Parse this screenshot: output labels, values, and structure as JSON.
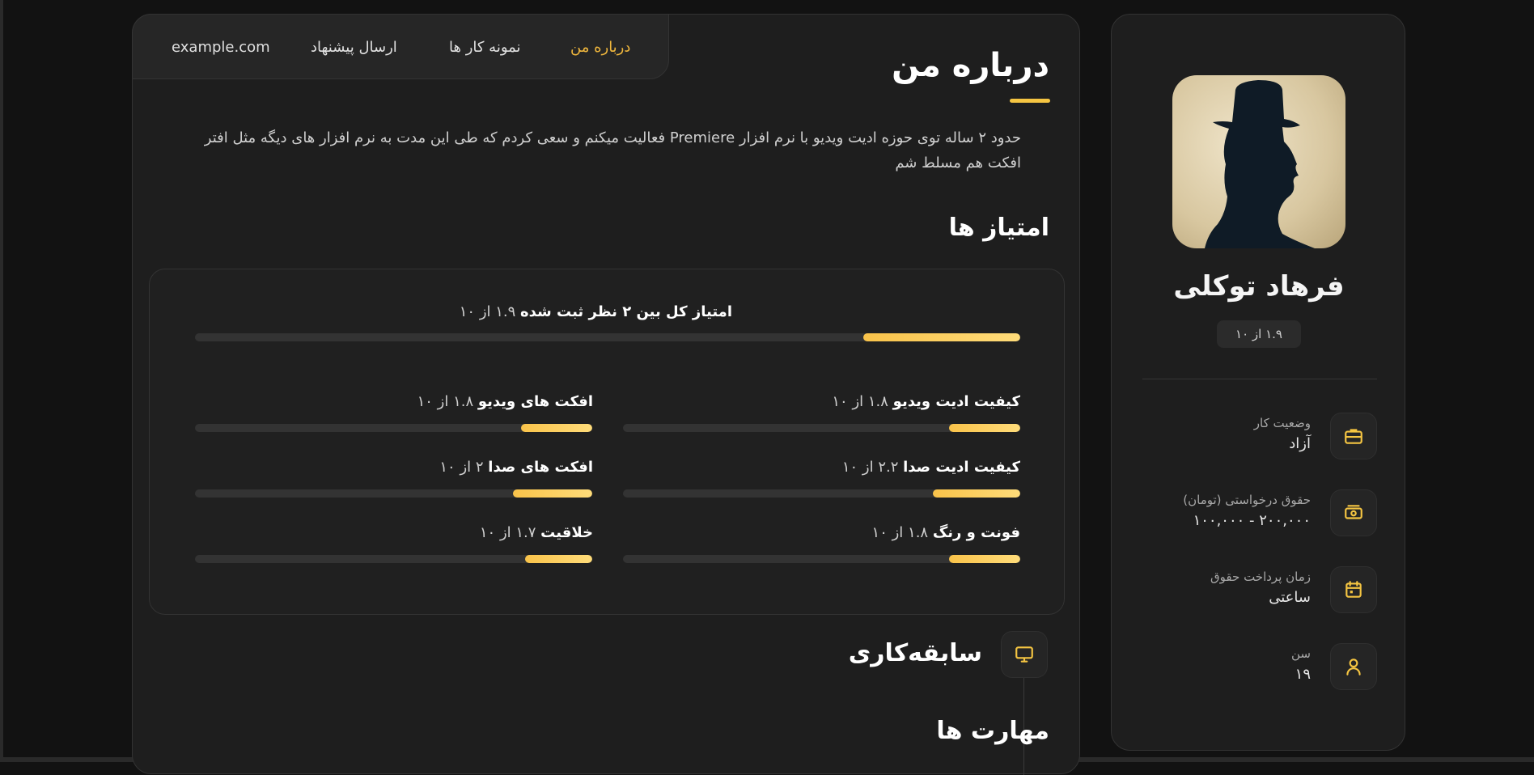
{
  "nav": {
    "items": [
      {
        "label": "درباره من",
        "active": true
      },
      {
        "label": "نمونه کار ها",
        "active": false
      },
      {
        "label": "ارسال پیشنهاد",
        "active": false
      },
      {
        "label": "example.com",
        "active": false
      }
    ]
  },
  "about": {
    "title": "درباره من",
    "text": "حدود ۲ ساله توی حوزه ادیت ویدیو با نرم افزار Premiere فعالیت میکنم و سعی کردم که طی این مدت به نرم افزار های دیگه مثل افتر افکت هم مسلط شم"
  },
  "scores": {
    "title": "امتیاز ها",
    "overall": {
      "label": "امتیاز کل بین ۲ نظر ثبت شده",
      "value_text": "۱.۹ از ۱۰",
      "value": 1.9,
      "max": 10
    },
    "items": [
      {
        "label": "کیفیت ادیت ویدیو",
        "value_text": "۱.۸ از ۱۰",
        "value": 1.8
      },
      {
        "label": "افکت های ویدیو",
        "value_text": "۱.۸ از ۱۰",
        "value": 1.8
      },
      {
        "label": "کیفیت ادیت صدا",
        "value_text": "۲.۲ از ۱۰",
        "value": 2.2
      },
      {
        "label": "افکت های صدا",
        "value_text": "۲ از ۱۰",
        "value": 2
      },
      {
        "label": "فونت و رنگ",
        "value_text": "۱.۸ از ۱۰",
        "value": 1.8
      },
      {
        "label": "خلاقیت",
        "value_text": "۱.۷ از ۱۰",
        "value": 1.7
      }
    ]
  },
  "history": {
    "title": "سابقه‌کاری"
  },
  "skills": {
    "title": "مهارت ها"
  },
  "profile": {
    "name": "فرهاد توکلی",
    "rating": "۱.۹ از ۱۰",
    "info": [
      {
        "label": "وضعیت کار",
        "value": "آزاد",
        "icon": "briefcase-icon"
      },
      {
        "label": "حقوق درخواستی (تومان)",
        "value": "۲۰۰,۰۰۰ - ۱۰۰,۰۰۰",
        "icon": "money-icon"
      },
      {
        "label": "زمان پرداخت حقوق",
        "value": "ساعتی",
        "icon": "calendar-icon"
      },
      {
        "label": "سن",
        "value": "۱۹",
        "icon": "user-icon"
      }
    ]
  },
  "colors": {
    "accent": "#f5c542",
    "background": "#121212",
    "panel": "#1e1e1e"
  }
}
